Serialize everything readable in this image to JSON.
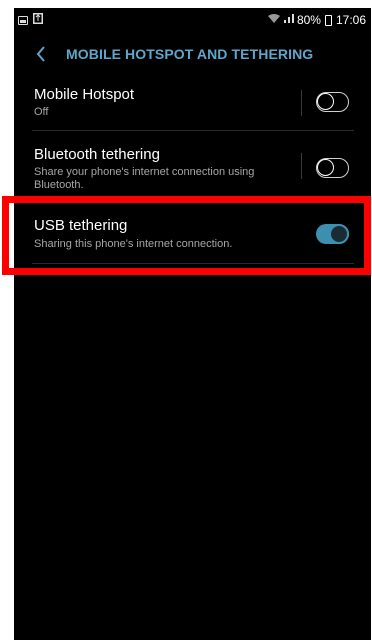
{
  "status_bar": {
    "left_icons": [
      "image-icon",
      "usb-icon"
    ],
    "battery_percent": "80%",
    "time": "17:06"
  },
  "header": {
    "back_icon": "chevron-left-icon",
    "title": "MOBILE HOTSPOT AND TETHERING"
  },
  "settings": [
    {
      "title": "Mobile Hotspot",
      "subtitle": "Off",
      "enabled": false
    },
    {
      "title": "Bluetooth tethering",
      "subtitle": "Share your phone's internet connection using Bluetooth.",
      "enabled": false
    },
    {
      "title": "USB tethering",
      "subtitle": "Sharing this phone's internet connection.",
      "enabled": true
    }
  ],
  "colors": {
    "accent": "#5ea6cc",
    "toggle_on": "#3d8fb0",
    "highlight": "#ff0000"
  }
}
